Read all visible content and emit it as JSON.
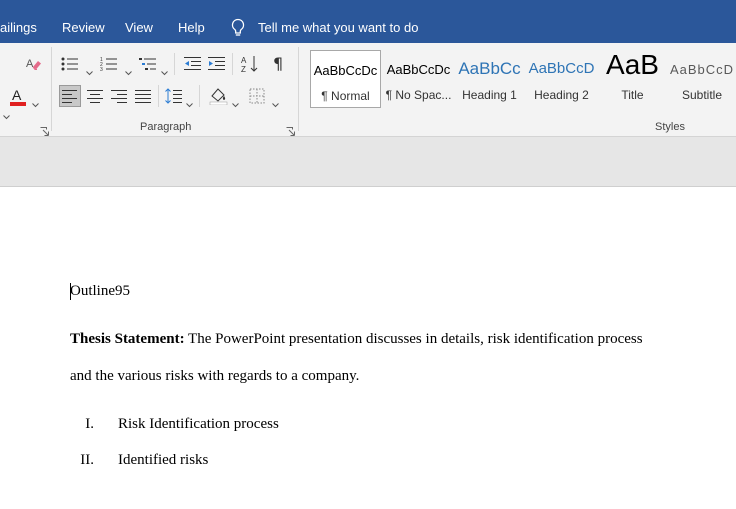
{
  "menu": {
    "tabs": [
      "ailings",
      "Review",
      "View",
      "Help"
    ],
    "tell_me": "Tell me what you want to do"
  },
  "ribbon": {
    "paragraph_label": "Paragraph",
    "styles_label": "Styles",
    "font_color_hex": "#e02020",
    "icons": [
      "eraser-icon",
      "font-color-icon",
      "bullets-icon",
      "numbering-icon",
      "multilevel-list-icon",
      "decrease-indent-icon",
      "increase-indent-icon",
      "sort-icon",
      "pilcrow-icon",
      "align-left-icon",
      "center-icon",
      "align-right-icon",
      "justify-icon",
      "line-spacing-icon",
      "shading-icon",
      "borders-icon"
    ],
    "styles": [
      {
        "preview": "AaBbCcDc",
        "name": "¶ Normal",
        "selected": true
      },
      {
        "preview": "AaBbCcDc",
        "name": "¶ No Spac...",
        "selected": false
      },
      {
        "preview": "AaBbCc",
        "name": "Heading 1",
        "selected": false
      },
      {
        "preview": "AaBbCcD",
        "name": "Heading 2",
        "selected": false
      },
      {
        "preview": "AaB",
        "name": "Title",
        "selected": false
      },
      {
        "preview": "AaBbCcD",
        "name": "Subtitle",
        "selected": false
      }
    ]
  },
  "document": {
    "title": "Outline95",
    "thesis_label": "Thesis Statement:",
    "thesis_line1": " The PowerPoint presentation discusses in details, risk identification process",
    "thesis_line2": "and the various risks with regards to a company.",
    "list": [
      {
        "num": "I.",
        "text": "Risk Identification process"
      },
      {
        "num": "II.",
        "text": "Identified risks"
      }
    ]
  }
}
